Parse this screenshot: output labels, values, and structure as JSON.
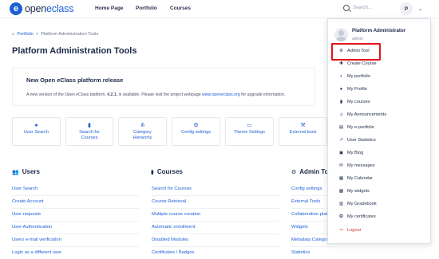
{
  "header": {
    "logo_mark": "e",
    "logo_text_a": "open",
    "logo_text_b": "eclass",
    "nav": [
      "Home Page",
      "Portfolio",
      "Courses"
    ],
    "search_placeholder": "Search...",
    "avatar_initial": "P"
  },
  "breadcrumb": {
    "portfolio": "Portfolio",
    "sep": ">",
    "current": "Platform Administration Tools"
  },
  "page_title": "Platform Administration Tools",
  "release": {
    "title": "New Open eClass platform release",
    "text_prefix": "A new version of the Open eClass platform, ",
    "version": "4.2.1",
    "text_mid": ", is available. Please visit the project webpage ",
    "link": "www.openeclass.org",
    "text_suffix": " for upgrade information."
  },
  "tiles": [
    {
      "label1": "User Search",
      "label2": "",
      "icon": "user-icon"
    },
    {
      "label1": "Search for",
      "label2": "Courses",
      "icon": "book-icon"
    },
    {
      "label1": "Category",
      "label2": "Hierarchy",
      "icon": "hierarchy-icon"
    },
    {
      "label1": "Config settings",
      "label2": "",
      "icon": "gear-icon"
    },
    {
      "label1": "Theme Settings",
      "label2": "",
      "icon": "monitor-icon"
    },
    {
      "label1": "External tools",
      "label2": "",
      "icon": "wrench-icon"
    }
  ],
  "sections": {
    "users": {
      "title": "Users",
      "icon": "users-icon",
      "links": [
        "User Search",
        "Create Account",
        "User requests",
        "User Authentication",
        "Users e-mail verification",
        "Login as a different user"
      ]
    },
    "courses": {
      "title": "Courses",
      "icon": "book-icon",
      "links": [
        "Search for Courses",
        "Course Retrieval",
        "Multiple course creation",
        "Automatic enrollment",
        "Disabled Modules",
        "Certificates / Badges"
      ]
    },
    "admin": {
      "title": "Admin Tools",
      "icon": "gear-icon",
      "links": [
        "Config settings",
        "External Tools",
        "Collaboration platform",
        "Widgets",
        "Metadata Categories",
        "Statistics"
      ]
    }
  },
  "dropdown": {
    "name": "Platform Administrator",
    "role": "admin",
    "items": [
      {
        "label": "Admin Tool",
        "icon": "gear-icon"
      },
      {
        "label": "Create Course",
        "icon": "plus-icon"
      },
      {
        "label": "My portfolio",
        "icon": "briefcase-icon"
      },
      {
        "label": "My Profile",
        "icon": "user-icon"
      },
      {
        "label": "My courses",
        "icon": "book-icon"
      },
      {
        "label": "My Announcements",
        "icon": "bell-icon"
      },
      {
        "label": "My e-portfolio",
        "icon": "document-icon"
      },
      {
        "label": "User Statistics",
        "icon": "chart-icon"
      },
      {
        "label": "My Blog",
        "icon": "blog-icon"
      },
      {
        "label": "My messages",
        "icon": "envelope-icon"
      },
      {
        "label": "My Calendar",
        "icon": "calendar-icon"
      },
      {
        "label": "My widgets",
        "icon": "widget-icon"
      },
      {
        "label": "My Gradebook",
        "icon": "gradebook-icon"
      },
      {
        "label": "My certificates",
        "icon": "certificate-icon"
      },
      {
        "label": "Logout",
        "icon": "logout-icon"
      }
    ]
  },
  "colors": {
    "accent": "#1d5fd4",
    "highlight": "#e0151e",
    "logout": "#d23a2a",
    "text": "#1c2a4a"
  }
}
